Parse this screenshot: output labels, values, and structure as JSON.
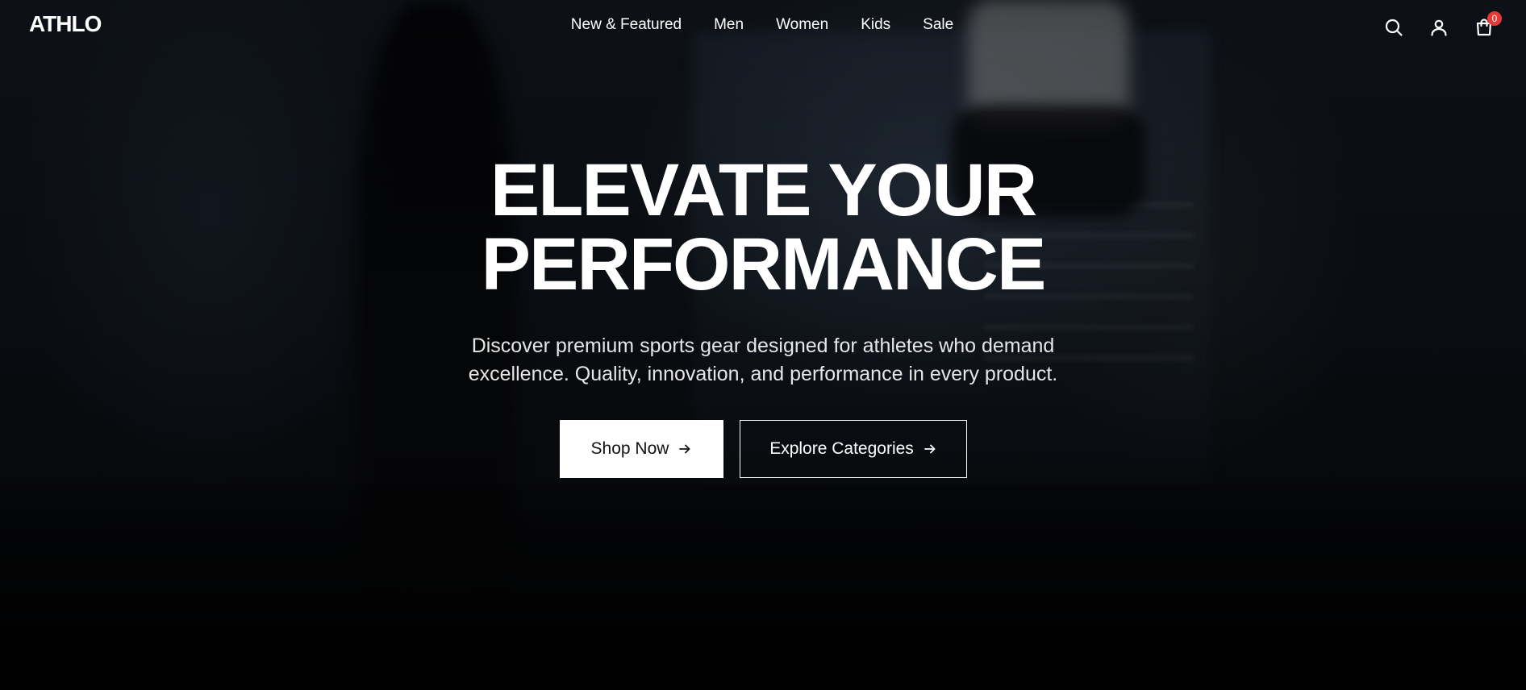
{
  "brand": {
    "logo_text": "ATHLO"
  },
  "nav": {
    "items": [
      {
        "label": "New & Featured"
      },
      {
        "label": "Men"
      },
      {
        "label": "Women"
      },
      {
        "label": "Kids"
      },
      {
        "label": "Sale"
      }
    ]
  },
  "header_icons": {
    "search": "search-icon",
    "account": "user-icon",
    "cart": "shopping-bag-icon",
    "cart_count": "0"
  },
  "hero": {
    "title_line1": "ELEVATE YOUR",
    "title_line2": "PERFORMANCE",
    "subtitle": "Discover premium sports gear designed for athletes who demand excellence. Quality, innovation, and performance in every product.",
    "primary_button": "Shop Now",
    "secondary_button": "Explore Categories"
  },
  "colors": {
    "badge": "#e53935",
    "primary_button_bg": "#ffffff",
    "text": "#ffffff"
  }
}
